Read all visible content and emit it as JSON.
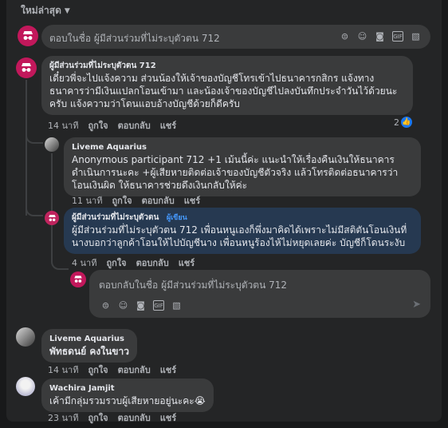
{
  "sort_label": "ใหม่ล่าสุด",
  "top_compose": {
    "placeholder": "ตอบในชื่อ ผู้มีส่วนร่วมที่ไม่ระบุตัวตน 712",
    "icons": [
      "emoji-icon",
      "smiley-icon",
      "camera-icon",
      "gif-icon",
      "sticker-icon"
    ]
  },
  "comments": [
    {
      "author": "ผู้มีส่วนร่วมที่ไม่ระบุตัวตน 712",
      "text": "เดี๋ยวพี่จะไปแจ้งความ ส่วนน้องให้เจ้าของบัญชีโทรเข้าไปธนาคารกสิกร แจ้งทางธนาคารว่ามีเงินแปลกโอนเข้ามา และน้องเจ้าของบัญชีไปลงบันทึกประจำวันไว้ด้วยนะครับ แจ้งความว่าโดนแอบอ้างบัญชีด้วยก็ดีครับ",
      "time": "14 นาที",
      "like": "ถูกใจ",
      "reply": "ตอบกลับ",
      "share": "แชร์",
      "reactions": "2"
    },
    {
      "author": "Liveme Aquarius",
      "text": "Anonymous participant 712 +1 เม้นนี้ค่ะ แนะนำให้เรื่องคืนเงินให้ธนาคารดำเนินการนะคะ +ผู้เสียหายติดต่อเจ้าของบัญชีตัวจริง แล้วโทรติดต่อธนาคารว่าโอนเงินผิด ให้ธนาคารช่วยดึงเงินกลับให้ค่ะ",
      "time": "11 นาที",
      "like": "ถูกใจ",
      "reply": "ตอบกลับ",
      "share": "แชร์"
    },
    {
      "author": "ผู้มีส่วนร่วมที่ไม่ระบุตัวตน",
      "badge": "ผู้เขียน",
      "text": "ผู้มีส่วนร่วมที่ไม่ระบุตัวตน 712 เพื่อนหนูเองก็พึ่งมาคิดได้เพราะไม่มีสติตันโอนเงินที่นางบอกว่าลูกค้าโอนให้ไปบัญชีนาง เพื่อนหนูร้องไห้ไม่หยุดเลยค่ะ บัญชีก็โดนระงับ",
      "time": "4 นาที",
      "like": "ถูกใจ",
      "reply": "ตอบกลับ",
      "share": "แชร์"
    },
    {
      "author": "Liveme Aquarius",
      "text": "พัทธดนย์ คงในขาว",
      "time": "14 นาที",
      "like": "ถูกใจ",
      "reply": "ตอบกลับ",
      "share": "แชร์"
    },
    {
      "author": "Wachira Jamjit",
      "text": "เค้ามีกลุ่มรวมรวบผู้เสียหายอยู่นะคะ😭",
      "time": "23 นาที",
      "like": "ถูกใจ",
      "reply": "ตอบกลับ",
      "share": "แชร์"
    }
  ],
  "reply_compose": {
    "placeholder": "ตอบกลับในชื่อ ผู้มีส่วนร่วมที่ไม่ระบุตัวตน 712",
    "icons": [
      "emoji-icon",
      "smiley-icon",
      "camera-icon",
      "gif-icon",
      "sticker-icon"
    ],
    "send_icon": "send-icon"
  }
}
